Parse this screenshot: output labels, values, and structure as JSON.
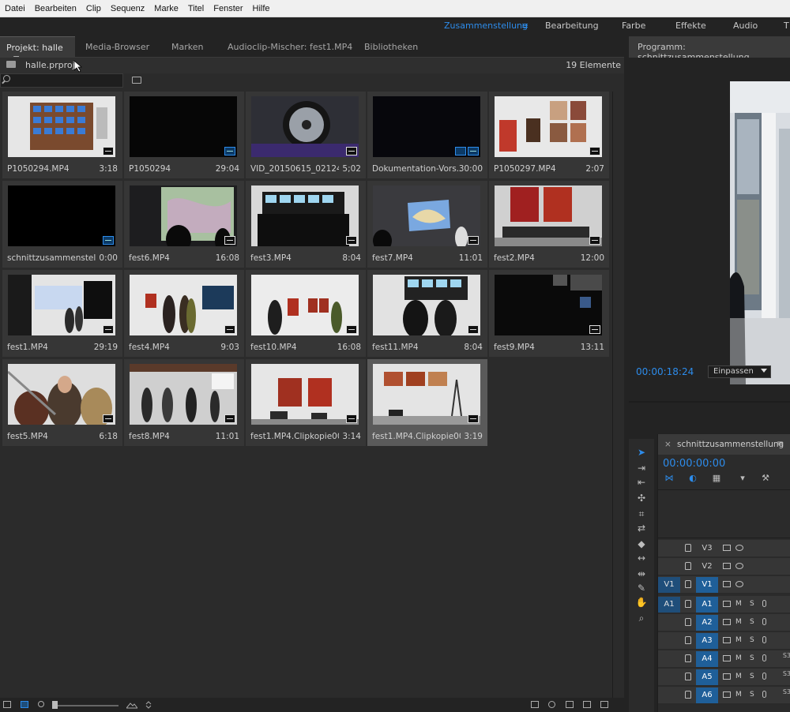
{
  "menubar": {
    "items": [
      "Datei",
      "Bearbeiten",
      "Clip",
      "Sequenz",
      "Marke",
      "Titel",
      "Fenster",
      "Hilfe"
    ]
  },
  "workspaces": {
    "active": "Zusammenstellung",
    "items": [
      "Bearbeitung",
      "Farbe",
      "Effekte",
      "Audio",
      "T"
    ]
  },
  "project": {
    "tabs": [
      "Projekt: halle",
      "Media-Browser",
      "Marken",
      "Audioclip-Mischer: fest1.MP4",
      "Bibliotheken"
    ],
    "file": "halle.prproj",
    "count": "19 Elemente",
    "search_value": ""
  },
  "items": [
    {
      "name": "P1050294.MP4",
      "dur": "3:18"
    },
    {
      "name": "P1050294",
      "dur": "29:04"
    },
    {
      "name": "VID_20150615_02124...",
      "dur": "5;02"
    },
    {
      "name": "Dokumentation-Vors...",
      "dur": "30:00"
    },
    {
      "name": "P1050297.MP4",
      "dur": "2:07"
    },
    {
      "name": "schnittzusammenstell...",
      "dur": "0:00"
    },
    {
      "name": "fest6.MP4",
      "dur": "16:08"
    },
    {
      "name": "fest3.MP4",
      "dur": "8:04"
    },
    {
      "name": "fest7.MP4",
      "dur": "11:01"
    },
    {
      "name": "fest2.MP4",
      "dur": "12:00"
    },
    {
      "name": "fest1.MP4",
      "dur": "29:19"
    },
    {
      "name": "fest4.MP4",
      "dur": "9:03"
    },
    {
      "name": "fest10.MP4",
      "dur": "16:08"
    },
    {
      "name": "fest11.MP4",
      "dur": "8:04"
    },
    {
      "name": "fest9.MP4",
      "dur": "13:11"
    },
    {
      "name": "fest5.MP4",
      "dur": "6:18"
    },
    {
      "name": "fest8.MP4",
      "dur": "11:01"
    },
    {
      "name": "fest1.MP4.Clipkopie001",
      "dur": "3:14"
    },
    {
      "name": "fest1.MP4.Clipkopie002",
      "dur": "3:19"
    }
  ],
  "program": {
    "title": "Programm: schnittzusammenstellung",
    "timecode": "00:00:18:24",
    "fit": "Einpassen"
  },
  "timeline": {
    "close": "×",
    "name": "schnittzusammenstellung",
    "timecode": "00:00:00:00",
    "tracks": [
      {
        "src": "",
        "name": "V3",
        "type": "video"
      },
      {
        "src": "",
        "name": "V2",
        "type": "video"
      },
      {
        "src": "V1",
        "name": "V1",
        "type": "video"
      },
      {
        "src": "A1",
        "name": "A1",
        "type": "audio"
      },
      {
        "src": "",
        "name": "A2",
        "type": "audio"
      },
      {
        "src": "",
        "name": "A3",
        "type": "audio"
      },
      {
        "src": "",
        "name": "A4",
        "type": "audio"
      },
      {
        "src": "",
        "name": "A5",
        "type": "audio"
      },
      {
        "src": "",
        "name": "A6",
        "type": "audio"
      }
    ],
    "m_label": "M",
    "s_label": "S",
    "cut_label": "S3"
  }
}
